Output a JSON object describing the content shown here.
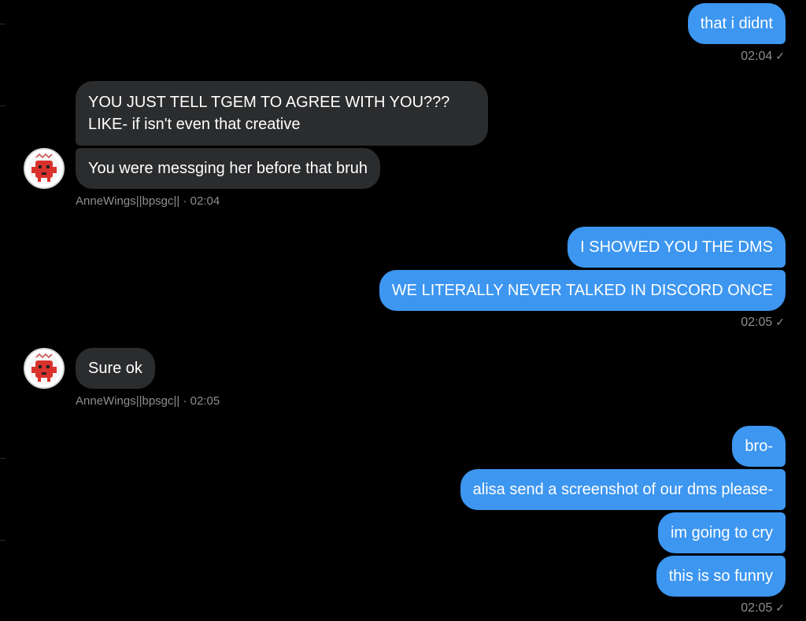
{
  "messages": {
    "m1_text": "that i didnt",
    "m1_time": "02:04",
    "m2_line1": "YOU JUST TELL TGEM TO AGREE WITH YOU???",
    "m2_line2": "LIKE- if isn't even that creative",
    "m3_text": "You were messging her before that bruh",
    "meta1_name": "AnneWings||bpsgc||",
    "meta1_time": "02:04",
    "m4_text": "I SHOWED YOU THE DMS",
    "m5_text": "WE LITERALLY NEVER TALKED IN DISCORD ONCE",
    "m5_time": "02:05",
    "m6_text": "Sure ok",
    "meta2_name": "AnneWings||bpsgc||",
    "meta2_time": "02:05",
    "m7_text": "bro-",
    "m8_text": "alisa send a screenshot of our dms please-",
    "m9_text": "im going to cry",
    "m10_text": "this is so funny",
    "m10_time": "02:05"
  },
  "colors": {
    "background": "#000000",
    "incoming_bubble": "#2b2c2e",
    "outgoing_bubble": "#3d96f0",
    "timestamp": "#8e8e93"
  },
  "icons": {
    "read_check": "✓",
    "avatar": "red-robot-avatar-icon"
  }
}
